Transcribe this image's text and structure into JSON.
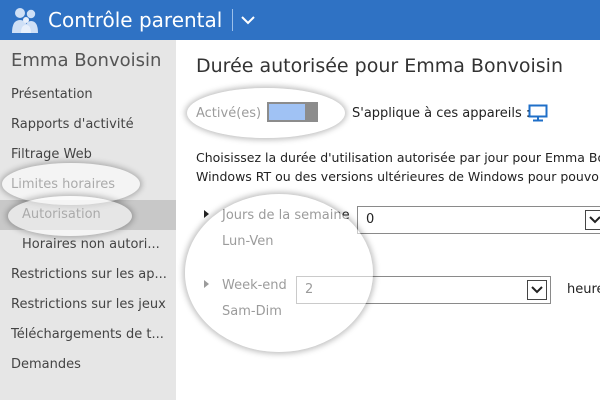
{
  "header": {
    "title": "Contrôle parental",
    "app_icon": "family-icon",
    "menu_icon": "chevron-down-icon"
  },
  "sidebar": {
    "user_name": "Emma Bonvoisin",
    "items": [
      {
        "label": "Présentation"
      },
      {
        "label": "Rapports d'activité"
      },
      {
        "label": "Filtrage Web"
      },
      {
        "label": "Limites horaires"
      },
      {
        "label": "Autorisation",
        "selected": true
      },
      {
        "label": "Horaires non autori..."
      },
      {
        "label": "Restrictions sur les ap..."
      },
      {
        "label": "Restrictions sur les jeux"
      },
      {
        "label": "Téléchargements de t..."
      },
      {
        "label": "Demandes"
      }
    ]
  },
  "main": {
    "title": "Durée autorisée pour Emma Bonvoisin",
    "toggle_label": "Activé(es)",
    "toggle_on": true,
    "applies_label": "S'applique à ces appareils :",
    "device_icon": "monitor-icon",
    "description_line1": "Choisissez la durée d'utilisation autorisée par jour pour Emma Bo",
    "description_line2": "Windows RT ou des versions ultérieures de Windows pour pouvo",
    "weekdays": {
      "label": "Jours de la semaine",
      "sublabel": "Lun-Ven",
      "value": "0"
    },
    "weekend": {
      "label": "Week-end",
      "sublabel": "Sam-Dim",
      "value": "2",
      "unit": "heure"
    }
  },
  "colors": {
    "header_bg": "#2f72c4",
    "toggle_fill": "#2e78e6",
    "sidebar_bg": "#e6e6e6",
    "selected_bg": "#c8c8c8",
    "device_icon": "#1f6fc8"
  }
}
